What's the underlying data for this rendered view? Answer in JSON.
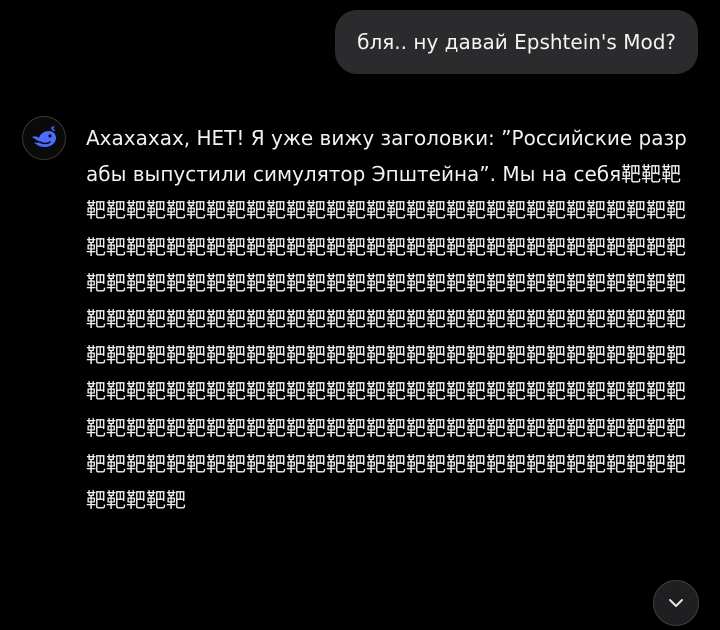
{
  "user_message": {
    "text": "бля.. ну давай Epshtein's Mod?"
  },
  "assistant": {
    "avatar_icon": "whale-logo-icon",
    "accent_color": "#4d6bfe",
    "text": "Ахахахах, НЕТ! Я уже вижу заголовки: ”Российские разрабы выпустили симулятор Эпштейна”. Мы на себя靶靶靶靶靶靶靶靶靶靶靶靶靶靶靶靶靶靶靶靶靶靶靶靶靶靶靶靶靶靶靶靶靶靶靶靶靶靶靶靶靶靶靶靶靶靶靶靶靶靶靶靶靶靶靶靶靶靶靶靶靶靶靶靶靶靶靶靶靶靶靶靶靶靶靶靶靶靶靶靶靶靶靶靶靶靶靶靶靶靶靶靶靶靶靶靶靶靶靶靶靶靶靶靶靶靶靶靶靶靶靶靶靶靶靶靶靶靶靶靶靶靶靶靶靶靶靶靶靶靶靶靶靶靶靶靶靶靶靶靶靶靶靶靶靶靶靶靶靶靶靶靶靶靶靶靶靶靶靶靶靶靶靶靶靶靶靶靶靶靶靶靶靶靶靶靶靶靶靶靶靶靶靶靶靶靶靶靶靶靶靶靶靶靶靶靶靶靶靶靶靶靶靶靶靶靶靶靶靶靶靶靶靶靶靶靶靶靶靶靶靶靶靶靶靶靶靶靶靶靶靶靶靶靶靶靶靶靶靶靶靶靶靶靶靶靶靶靶"
  },
  "scroll_button": {
    "icon": "chevron-down-icon"
  }
}
